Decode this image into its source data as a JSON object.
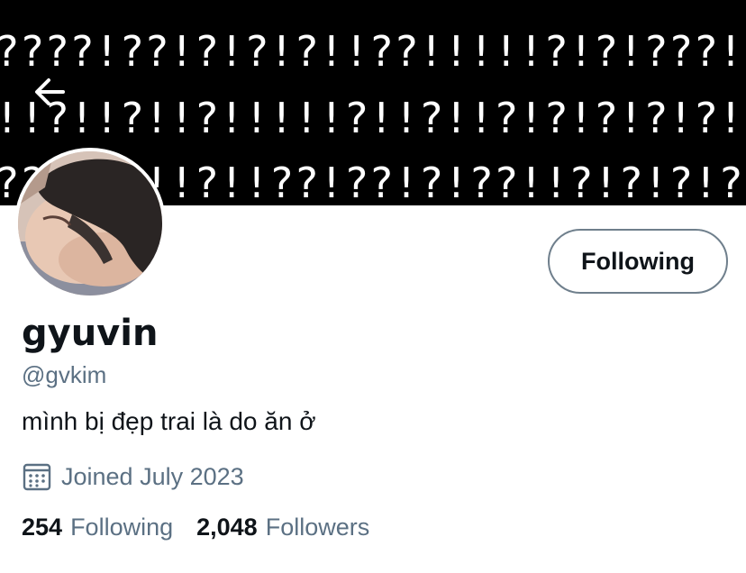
{
  "banner": {
    "lines": [
      "????!??!?!?!?!!??!!!!!?!?!???!?!!!!!?!???!?",
      "!!?!!?!!?!!!!!?!!?!!?!?!?!?!?!?!!?!?!!!?!!?!?!?",
      "??!!??!!?!!??!??!?!??!!?!?!?!?!!?!?!?!!!"
    ],
    "background": "#000000"
  },
  "nav": {
    "back_icon": "arrow-left-icon"
  },
  "profile": {
    "display_name": "gyuvin",
    "handle": "@gvkim",
    "bio": "mình bị đẹp trai là do ăn ở",
    "joined": "Joined July 2023",
    "joined_icon": "calendar-icon",
    "follow_button_label": "Following"
  },
  "stats": {
    "following_count": "254",
    "following_label": "Following",
    "followers_count": "2,048",
    "followers_label": "Followers"
  },
  "colors": {
    "text_primary": "#0f1419",
    "text_secondary": "#5b7083",
    "button_border": "#6f7f8c"
  }
}
